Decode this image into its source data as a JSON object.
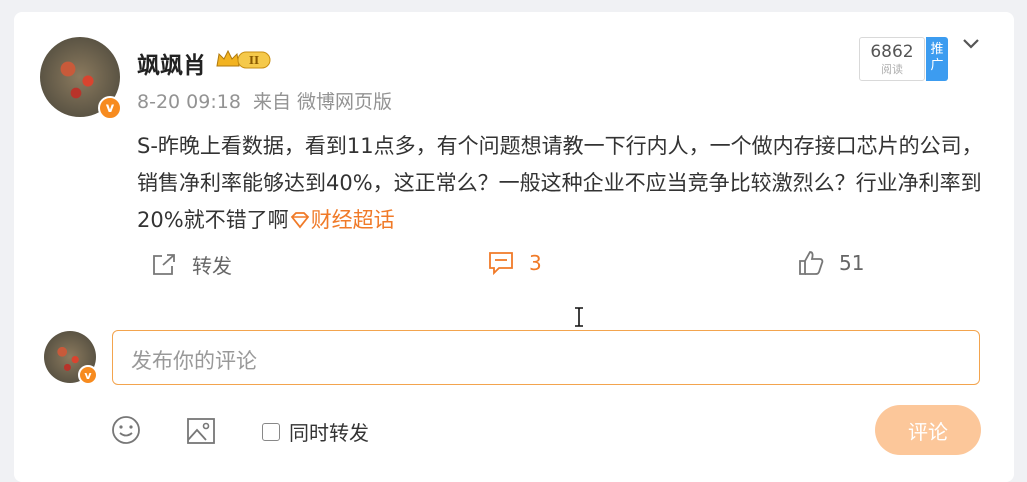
{
  "post": {
    "username": "飒飒肖",
    "time": "8-20 09:18",
    "source_prefix": "来自",
    "source": "微博网页版",
    "reads_count": "6862",
    "reads_label": "阅读",
    "promo_label": "推广",
    "content_text": "S-昨晚上看数据，看到11点多，有个问题想请教一下行内人，一个做内存接口芯片的公司，销售净利率能够达到40%，这正常么？一般这种企业不应当竞争比较激烈么？行业净利率到20%就不错了啊",
    "topic_label": "财经超话",
    "verified_badge": "v",
    "level_badge": "II"
  },
  "actions": {
    "forward_label": "转发",
    "comment_count": "3",
    "like_count": "51"
  },
  "composer": {
    "placeholder": "发布你的评论",
    "repost_label": "同时转发",
    "submit_label": "评论"
  },
  "colors": {
    "accent": "#f07a28",
    "promo_blue": "#3c9cf0",
    "verified_orange": "#f78b1f"
  },
  "icons": {
    "forward": "share-out-icon",
    "comment": "comment-bubble-icon",
    "like": "thumb-up-icon",
    "emoji": "smiley-icon",
    "image": "image-icon",
    "more": "chevron-down-icon"
  }
}
